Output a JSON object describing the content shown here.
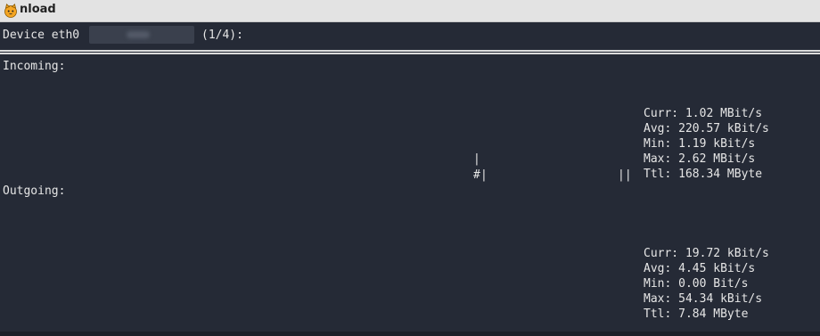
{
  "window": {
    "title": "nload",
    "app_icon": "cat-face-icon"
  },
  "header": {
    "device_label": "Device eth0",
    "page_indicator": "(1/4):"
  },
  "incoming": {
    "label": "Incoming:",
    "stats": {
      "curr": "Curr: 1.02 MBit/s",
      "avg": "Avg: 220.57 kBit/s",
      "min": "Min: 1.19 kBit/s",
      "max": "Max: 2.62 MBit/s",
      "ttl": "Ttl: 168.34 MByte"
    },
    "graph": {
      "bar_top": "|",
      "bar_bottom_hash": "#",
      "bar_bottom_pipe": "|",
      "bar_right": "||"
    }
  },
  "outgoing": {
    "label": "Outgoing:",
    "stats": {
      "curr": "Curr: 19.72 kBit/s",
      "avg": "Avg: 4.45 kBit/s",
      "min": "Min: 0.00 Bit/s",
      "max": "Max: 54.34 kBit/s",
      "ttl": "Ttl: 7.84 MByte"
    }
  },
  "colors": {
    "terminal_bg": "#252a36",
    "text": "#e6e6e6",
    "titlebar_bg": "#e3e3e3"
  }
}
